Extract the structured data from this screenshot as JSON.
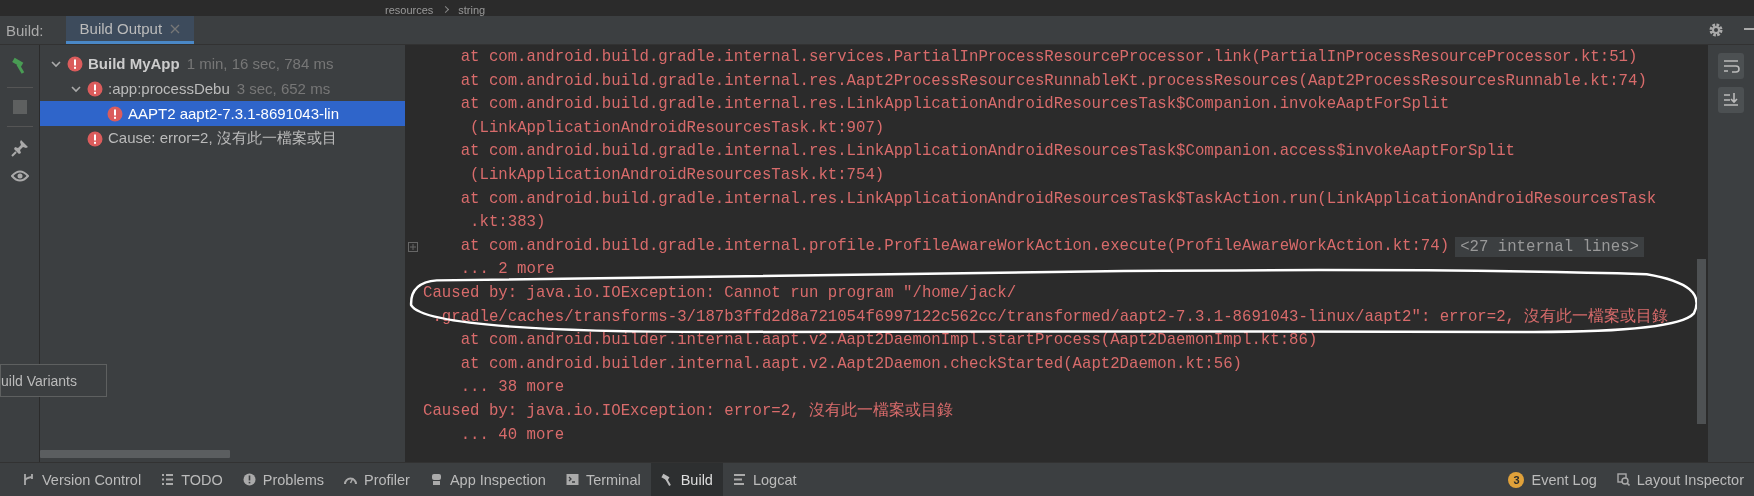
{
  "breadcrumb": [
    "resources",
    "string"
  ],
  "tool_window": {
    "label": "Build:",
    "tabs": [
      {
        "label": "Build Output",
        "selected": true,
        "closable": true
      }
    ]
  },
  "tree": [
    {
      "label": "Build MyApp",
      "time": "1 min, 16 sec, 784 ms",
      "bold": true,
      "expanded": true,
      "selected": false,
      "children": [
        {
          "label": ":app:processDebu",
          "time": "3 sec, 652 ms",
          "bold": false,
          "expanded": true,
          "selected": false,
          "children": [
            {
              "label": "AAPT2 aapt2-7.3.1-8691043-lin",
              "bold": false,
              "selected": true
            }
          ]
        },
        {
          "label": "Cause: error=2, 沒有此一檔案或目",
          "bold": false,
          "selected": false
        }
      ]
    }
  ],
  "console": {
    "lines": [
      {
        "kind": "at",
        "text": "at com.android.build.gradle.internal.services.PartialInProcessResourceProcessor.link(PartialInProcessResourceProcessor.kt:51)"
      },
      {
        "kind": "at",
        "text": "at com.android.build.gradle.internal.res.Aapt2ProcessResourcesRunnableKt.processResources(Aapt2ProcessResourcesRunnable.kt:74)"
      },
      {
        "kind": "at",
        "text": "at com.android.build.gradle.internal.res.LinkApplicationAndroidResourcesTask$Companion.invokeAaptForSplit"
      },
      {
        "kind": "at-cont",
        "text": "(LinkApplicationAndroidResourcesTask.kt:907)"
      },
      {
        "kind": "at",
        "text": "at com.android.build.gradle.internal.res.LinkApplicationAndroidResourcesTask$Companion.access$invokeAaptForSplit"
      },
      {
        "kind": "at-cont",
        "text": "(LinkApplicationAndroidResourcesTask.kt:754)"
      },
      {
        "kind": "at",
        "text": "at com.android.build.gradle.internal.res.LinkApplicationAndroidResourcesTask$TaskAction.run(LinkApplicationAndroidResourcesTask"
      },
      {
        "kind": "at-cont",
        "text": ".kt:383)"
      },
      {
        "kind": "at",
        "text": "at com.android.build.gradle.internal.profile.ProfileAwareWorkAction.execute(ProfileAwareWorkAction.kt:74)",
        "folded": "<27 internal lines>"
      },
      {
        "kind": "at",
        "text": "... 2 more"
      },
      {
        "kind": "caused",
        "text": "Caused by: java.io.IOException: Cannot run program \"/home/jack/"
      },
      {
        "kind": "caused-cont",
        "text": ".gradle/caches/transforms-3/187b3ffd2d8a721054f6997122c562cc/transformed/aapt2-7.3.1-8691043-linux/aapt2\": error=2, 沒有此一檔案或目錄"
      },
      {
        "kind": "at",
        "text": "at com.android.builder.internal.aapt.v2.Aapt2DaemonImpl.startProcess(Aapt2DaemonImpl.kt:86)"
      },
      {
        "kind": "at",
        "text": "at com.android.builder.internal.aapt.v2.Aapt2Daemon.checkStarted(Aapt2Daemon.kt:56)"
      },
      {
        "kind": "at",
        "text": "... 38 more"
      },
      {
        "kind": "caused",
        "text": "Caused by: java.io.IOException: error=2, 沒有此一檔案或目錄"
      },
      {
        "kind": "at",
        "text": "... 40 more"
      }
    ]
  },
  "tooltip": "uild Variants",
  "status_bar": {
    "left": [
      {
        "label": "Version Control",
        "selected": false
      },
      {
        "label": "TODO",
        "selected": false
      },
      {
        "label": "Problems",
        "selected": false
      },
      {
        "label": "Profiler",
        "selected": false
      },
      {
        "label": "App Inspection",
        "selected": false
      },
      {
        "label": "Terminal",
        "selected": false
      },
      {
        "label": "Build",
        "selected": true
      },
      {
        "label": "Logcat",
        "selected": false
      }
    ],
    "right": [
      {
        "label": "Event Log",
        "badge": "3"
      },
      {
        "label": "Layout Inspector"
      }
    ]
  }
}
